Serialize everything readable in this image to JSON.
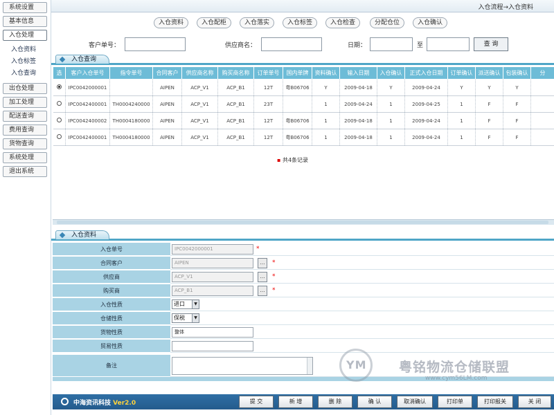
{
  "breadcrumb": "入仓流程→入仓资料",
  "sidebar": {
    "items": [
      {
        "label": "系统设置",
        "active": false
      },
      {
        "label": "基本信息",
        "active": false
      },
      {
        "label": "入仓处理",
        "active": true
      },
      {
        "label": "出仓处理",
        "active": false
      },
      {
        "label": "加工处理",
        "active": false
      },
      {
        "label": "配送查询",
        "active": false
      },
      {
        "label": "费用查询",
        "active": false
      },
      {
        "label": "货物查询",
        "active": false
      },
      {
        "label": "系统处理",
        "active": false
      },
      {
        "label": "退出系统",
        "active": false
      }
    ],
    "subitems": [
      "入仓资料",
      "入仓标签",
      "入仓查询"
    ]
  },
  "steps": [
    "入仓资料",
    "入仓配柜",
    "入仓落实",
    "入仓标签",
    "入仓检查",
    "分配仓位",
    "入仓确认"
  ],
  "search": {
    "customer_no_label": "客户单号：",
    "supplier_label": "供应商名：",
    "date_label": "日期：",
    "date_sep": "至",
    "button": "查 询"
  },
  "list_section": {
    "title": "入仓查询"
  },
  "table": {
    "headers": [
      "选",
      "客户入仓单号",
      "指令单号",
      "合同客户",
      "供应商名称",
      "购买商名称",
      "订单单号",
      "国内单牌",
      "资料确认",
      "输入日期",
      "入仓确认",
      "正式入仓日期",
      "订单确认",
      "派送确认",
      "包装确认",
      "分"
    ],
    "rows": [
      [
        "",
        "IPC0042000001",
        "",
        "AIPEN",
        "ACP_V1",
        "ACP_B1",
        "12T",
        "粤B06706",
        "Y",
        "2009-04-18",
        "Y",
        "2009-04-24",
        "Y",
        "Y",
        "Y",
        ""
      ],
      [
        "",
        "IPC0042400001",
        "TH0004240000",
        "AIPEN",
        "ACP_V1",
        "ACP_B1",
        "23T",
        "",
        "1",
        "2009-04-24",
        "1",
        "2009-04-25",
        "1",
        "F",
        "F",
        ""
      ],
      [
        "",
        "IPC0042400002",
        "TH0004180000",
        "AIPEN",
        "ACP_V1",
        "ACP_B1",
        "12T",
        "粤B06706",
        "1",
        "2009-04-18",
        "1",
        "2009-04-24",
        "1",
        "F",
        "F",
        ""
      ],
      [
        "",
        "IPC0042400001",
        "TH0004180000",
        "AIPEN",
        "ACP_V1",
        "ACP_B1",
        "12T",
        "粤B06706",
        "1",
        "2009-04-18",
        "1",
        "2009-04-24",
        "1",
        "F",
        "F",
        ""
      ]
    ],
    "selected_row": 0,
    "record_count": "共4条记录"
  },
  "form_section": {
    "title": "入仓资料"
  },
  "form": {
    "rows": [
      {
        "label": "入仓单号",
        "value": "IPC0042000001",
        "type": "text-req"
      },
      {
        "label": "合同客户",
        "value": "AIPEN",
        "type": "pick-req"
      },
      {
        "label": "供应商",
        "value": "ACP_V1",
        "type": "pick-req"
      },
      {
        "label": "购买商",
        "value": "ACP_B1",
        "type": "pick-req"
      },
      {
        "label": "入仓性质",
        "value": "进口",
        "type": "select"
      },
      {
        "label": "仓储性质",
        "value": "保税",
        "type": "select"
      },
      {
        "label": "货物性质",
        "value": "整体",
        "type": "text"
      },
      {
        "label": "贸易性质",
        "value": "",
        "type": "text"
      }
    ],
    "memo_label": "备注",
    "pick_symbol": "…",
    "required_mark": "*"
  },
  "footer": {
    "brand": "中海资讯科技",
    "version": "Ver2.0",
    "buttons": [
      "提 交",
      "新 增",
      "删 除",
      "确 认",
      "取消确认",
      "打印单",
      "打印报关",
      "关 闭"
    ]
  },
  "watermark": {
    "logo": "YM",
    "title": "粤铭物流仓储联盟",
    "url": "www.cym56LM.com"
  }
}
